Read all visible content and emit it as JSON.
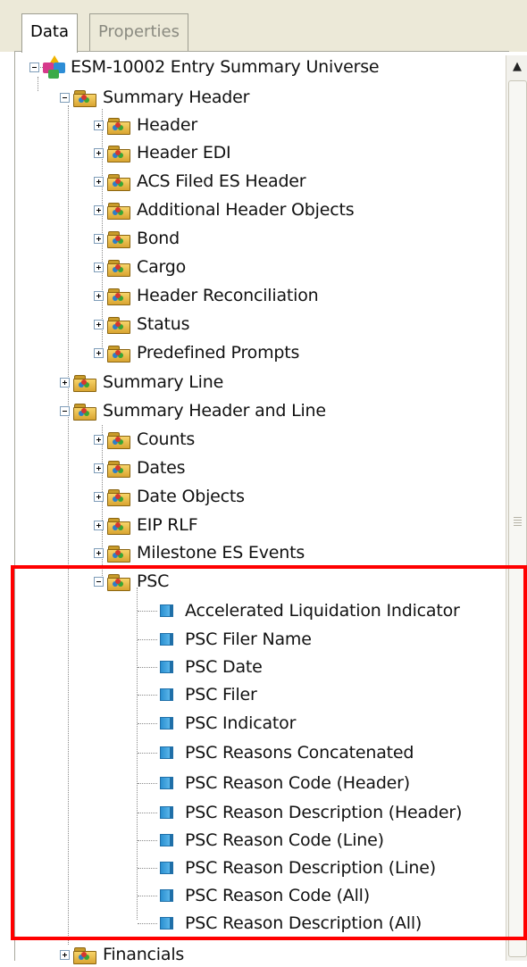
{
  "tabs": [
    {
      "label": "Data",
      "active": true
    },
    {
      "label": "Properties",
      "active": false
    }
  ],
  "tree": {
    "root": "ESM-10002 Entry Summary Universe",
    "summary_header": {
      "label": "Summary Header",
      "children": [
        "Header",
        "Header EDI",
        "ACS Filed ES Header",
        "Additional Header Objects",
        "Bond",
        "Cargo",
        "Header Reconciliation",
        "Status",
        "Predefined Prompts"
      ]
    },
    "summary_line": "Summary Line",
    "summary_header_and_line": {
      "label": "Summary Header and Line",
      "children": [
        "Counts",
        "Dates",
        "Date Objects",
        "EIP RLF",
        "Milestone ES Events"
      ]
    },
    "psc": {
      "label": "PSC",
      "objects": [
        "Accelerated Liquidation Indicator",
        "PSC Filer Name",
        "PSC Date",
        "PSC Filer",
        "PSC Indicator",
        "PSC Reasons Concatenated",
        "PSC Reason Code (Header)",
        "PSC Reason Description (Header)",
        "PSC Reason Code (Line)",
        "PSC Reason Description (Line)",
        "PSC Reason Code (All)",
        "PSC Reason Description (All)"
      ]
    },
    "financials": "Financials"
  },
  "colors": {
    "highlight_border": "#ff0000",
    "tab_bg": "#ece9d8"
  },
  "icons": {
    "class": "folder-class-icon",
    "object": "dimension-object-icon",
    "universe": "universe-icon",
    "expand": "expand-icon",
    "collapse": "collapse-icon"
  }
}
